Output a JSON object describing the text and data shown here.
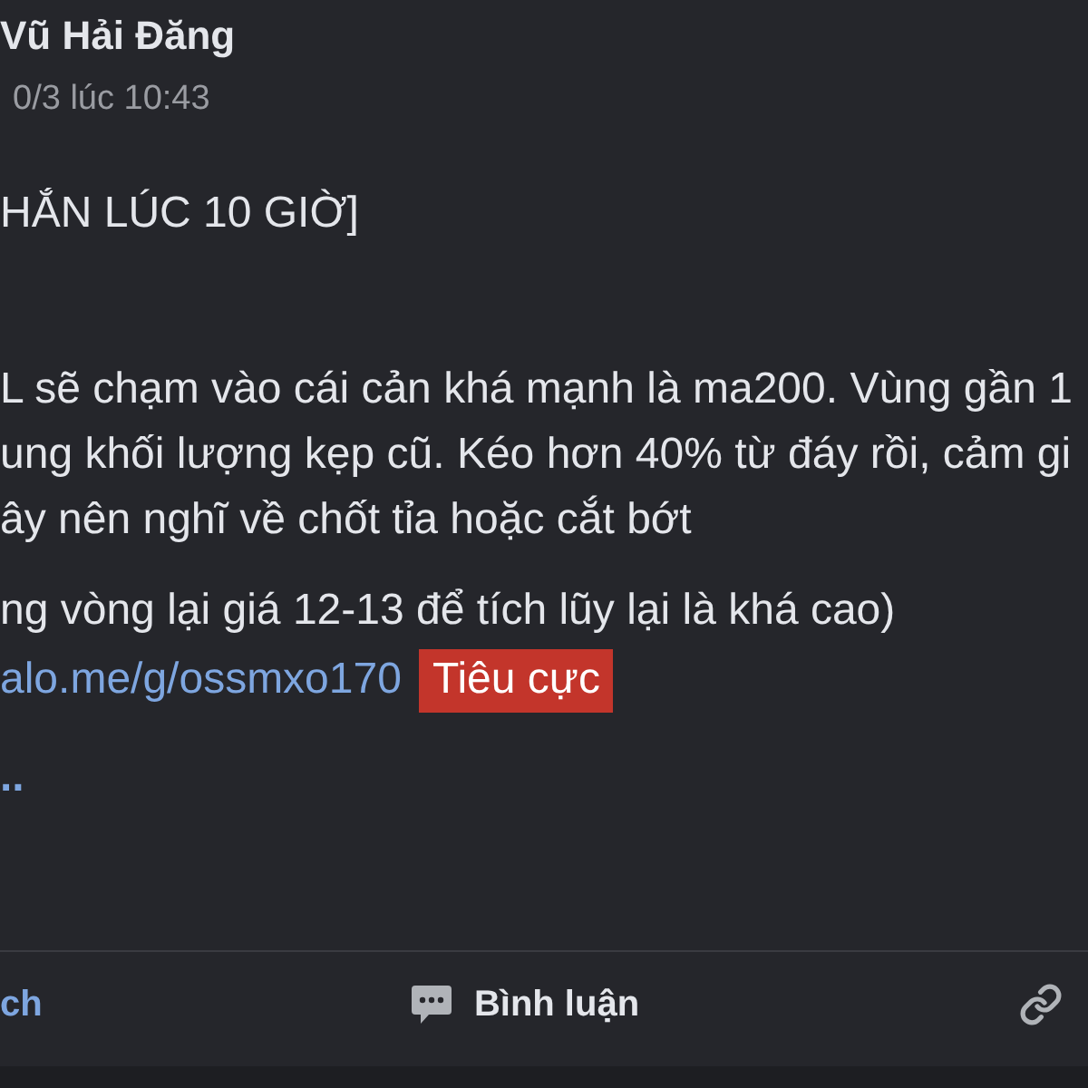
{
  "post": {
    "author": "Vũ Hải Đăng",
    "timestamp": "0/3 lúc 10:43",
    "paragraphs": [
      {
        "lines": [
          "HẮN LÚC 10 GIỜ]"
        ]
      },
      {
        "lines": [
          "L sẽ chạm vào cái cản khá mạnh là ma200. Vùng gần 1",
          "ung khối lượng kẹp cũ. Kéo hơn 40% từ đáy rồi, cảm gi",
          "ây nên nghĩ về chốt tỉa hoặc cắt bớt"
        ]
      },
      {
        "lines": [
          "ng vòng lại giá 12-13 để tích lũy lại là khá cao)"
        ]
      }
    ],
    "link": "alo.me/g/ossmxo170",
    "tags": [
      {
        "label": "Tiêu cực",
        "color": "#c3352b"
      }
    ],
    "see_more": ".."
  },
  "actions": [
    {
      "kind": "like",
      "label": "ch",
      "active": true
    },
    {
      "kind": "comment",
      "label": "Bình luận",
      "active": false
    },
    {
      "kind": "share",
      "active": false
    }
  ]
}
